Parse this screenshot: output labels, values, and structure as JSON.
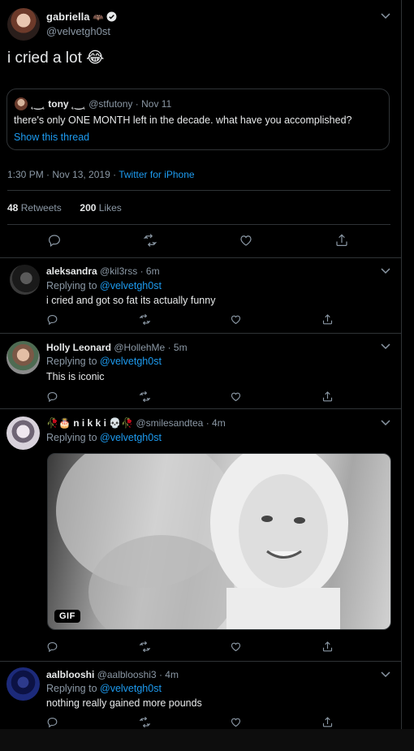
{
  "main_tweet": {
    "display_name": "gabriella",
    "name_emoji": "🦇",
    "handle": "@velvetgh0st",
    "text": "i cried a lot",
    "text_emoji": "😂",
    "quote": {
      "display_name": "˛‿˛ tony ˛‿˛",
      "handle": "@stfutony",
      "sep": "·",
      "date": "Nov 11",
      "text": "there's only ONE MONTH left in the decade. what have you accomplished?",
      "show_thread": "Show this thread"
    },
    "timestamp": "1:30 PM · Nov 13, 2019 · ",
    "source": "Twitter for iPhone",
    "retweets_count": "48",
    "retweets_label": "Retweets",
    "likes_count": "200",
    "likes_label": "Likes"
  },
  "replies": [
    {
      "display_name": "aleksandra",
      "handle": "@kil3rss",
      "time": "· 6m",
      "replying_prefix": "Replying to ",
      "replying_handle": "@velvetgh0st",
      "text": "i cried and got so fat its actually funny"
    },
    {
      "display_name": "Holly Leonard",
      "handle": "@HollehMe",
      "time": "· 5m",
      "replying_prefix": "Replying to ",
      "replying_handle": "@velvetgh0st",
      "text": "This is iconic"
    },
    {
      "display_name": "🥀🎂 n i k k i 💀🥀",
      "handle": "@smilesandtea",
      "time": "· 4m",
      "replying_prefix": "Replying to ",
      "replying_handle": "@velvetgh0st",
      "gif_label": "GIF"
    },
    {
      "display_name": "aalblooshi",
      "handle": "@aalblooshi3",
      "time": "· 4m",
      "replying_prefix": "Replying to ",
      "replying_handle": "@velvetgh0st",
      "text": "nothing really gained more pounds"
    }
  ],
  "colors": {
    "background": "#000000",
    "link": "#1d9bf0",
    "muted": "#8b98a5",
    "divider": "#2f3336"
  },
  "icons": [
    "reply-icon",
    "retweet-icon",
    "like-icon",
    "share-icon",
    "chevron-down-icon",
    "verified-badge-icon"
  ]
}
